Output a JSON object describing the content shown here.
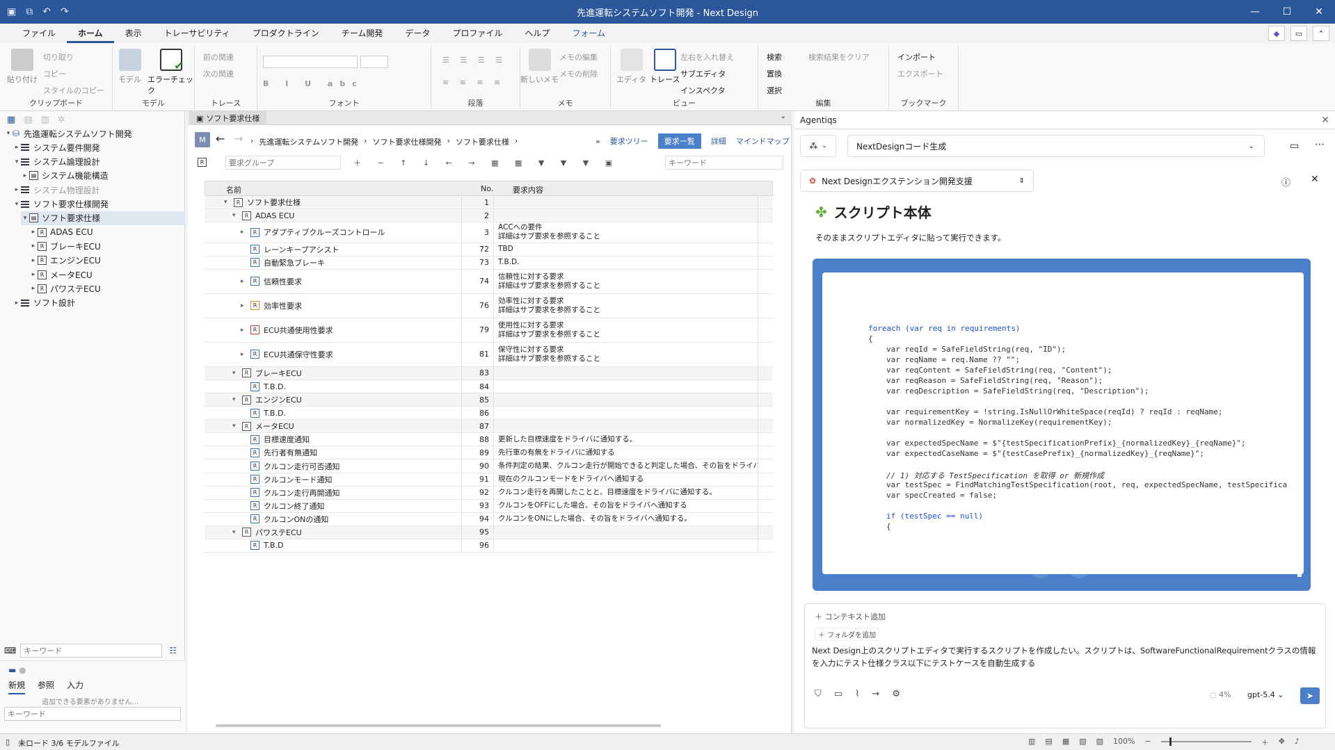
{
  "window": {
    "title": "先進運転システムソフト開発 - Next Design"
  },
  "menu": [
    "ファイル",
    "ホーム",
    "表示",
    "トレーサビリティ",
    "プロダクトライン",
    "チーム開発",
    "データ",
    "プロファイル",
    "ヘルプ",
    "フォーム"
  ],
  "ribbon": {
    "clipboard": {
      "paste": "貼り付け",
      "cut": "切り取り",
      "copy": "コピー",
      "style_copy": "スタイルのコピー",
      "label": "クリップボード"
    },
    "model": {
      "model": "モデル",
      "error_check": "エラーチェック",
      "label": "モデル"
    },
    "trace": {
      "prev": "前の関連",
      "next": "次の関連",
      "label": "トレース"
    },
    "font": {
      "label": "フォント"
    },
    "paragraph": {
      "label": "段落"
    },
    "memo": {
      "new_memo": "新しいメモ",
      "edit": "メモの編集",
      "delete": "メモの削除",
      "label": "メモ"
    },
    "view": {
      "editor": "エディタ",
      "trace": "トレース",
      "swap": "左右を入れ替え",
      "subeditor": "サブエディタ",
      "inspector": "インスペクタ",
      "label": "ビュー"
    },
    "edit": {
      "search": "検索",
      "replace": "置換",
      "select": "選択",
      "clear": "検索結果をクリア",
      "label": "編集"
    },
    "bookmark": {
      "import": "インポート",
      "export": "エクスポート",
      "label": "ブックマーク"
    }
  },
  "left": {
    "tree": [
      {
        "label": "先進運転システムソフト開発",
        "level": 0,
        "icon": "project-icon",
        "toggle": "▾"
      },
      {
        "label": "システム要件開発",
        "level": 1,
        "icon": "list-icon",
        "toggle": "▸"
      },
      {
        "label": "システム論理設計",
        "level": 1,
        "icon": "list-icon",
        "toggle": "▾"
      },
      {
        "label": "システム機能構造",
        "level": 2,
        "icon": "diagram-icon",
        "toggle": "▸"
      },
      {
        "label": "システム物理設計",
        "level": 1,
        "icon": "list-icon",
        "toggle": "▸",
        "dim": true
      },
      {
        "label": "ソフト要求仕様開発",
        "level": 1,
        "icon": "list-icon",
        "toggle": "▾"
      },
      {
        "label": "ソフト要求仕様",
        "level": 2,
        "icon": "diagram-icon",
        "toggle": "▾",
        "selected": true
      },
      {
        "label": "ADAS ECU",
        "level": 3,
        "icon": "r-icon",
        "toggle": "▸"
      },
      {
        "label": "ブレーキECU",
        "level": 3,
        "icon": "r-icon",
        "toggle": "▸"
      },
      {
        "label": "エンジンECU",
        "level": 3,
        "icon": "r-icon",
        "toggle": "▸"
      },
      {
        "label": "メータECU",
        "level": 3,
        "icon": "r-icon",
        "toggle": "▸"
      },
      {
        "label": "パワステECU",
        "level": 3,
        "icon": "r-icon",
        "toggle": "▸"
      },
      {
        "label": "ソフト設計",
        "level": 1,
        "icon": "list-icon",
        "toggle": "▸"
      }
    ],
    "keyword_placeholder": "キーワード",
    "tabs": [
      "新規",
      "参照",
      "入力"
    ],
    "empty_msg": "追加できる要素がありません...",
    "keyword2_placeholder": "キーワード"
  },
  "center": {
    "doc_tab": "ソフト要求仕様",
    "breadcrumb": [
      "先進運転システムソフト開発",
      "ソフト要求仕様開発",
      "ソフト要求仕様"
    ],
    "views": [
      "要求ツリー",
      "要求一覧",
      "詳細",
      "マインドマップ"
    ],
    "group_placeholder": "要求グループ",
    "keyword_placeholder": "キーワード",
    "columns": [
      "名前",
      "No.",
      "要求内容"
    ],
    "rows": [
      {
        "name": "ソフト要求仕様",
        "no": "1",
        "content": [],
        "indent": 0,
        "toggle": "▾",
        "group": true,
        "h": 18
      },
      {
        "name": "ADAS ECU",
        "no": "2",
        "content": [],
        "indent": 1,
        "toggle": "▾",
        "group": true,
        "h": 18
      },
      {
        "name": "アダプティブクルーズコントロール",
        "no": "3",
        "content": [
          "ACCへの要件",
          "詳細はサブ要求を参照すること"
        ],
        "indent": 2,
        "toggle": "▸",
        "h": 28
      },
      {
        "name": "レーンキープアシスト",
        "no": "72",
        "content": [
          "TBD"
        ],
        "indent": 2,
        "h": 18
      },
      {
        "name": "自動緊急ブレーキ",
        "no": "73",
        "content": [
          "T.B.D."
        ],
        "indent": 2,
        "h": 18
      },
      {
        "name": "信頼性要求",
        "no": "74",
        "content": [
          "信頼性に対する要求",
          "詳細はサブ要求を参照すること"
        ],
        "indent": 2,
        "toggle": "▸",
        "h": 33
      },
      {
        "name": "効率性要求",
        "no": "76",
        "content": [
          "効率性に対する要求",
          "詳細はサブ要求を参照すること"
        ],
        "indent": 2,
        "toggle": "▸",
        "h": 33,
        "orange": true
      },
      {
        "name": "ECU共通使用性要求",
        "no": "79",
        "content": [
          "使用性に対する要求",
          "詳細はサブ要求を参照すること"
        ],
        "indent": 2,
        "toggle": "▸",
        "h": 33,
        "red": true
      },
      {
        "name": "ECU共通保守性要求",
        "no": "81",
        "content": [
          "保守性に対する要求",
          "詳細はサブ要求を参照すること"
        ],
        "indent": 2,
        "toggle": "▸",
        "h": 33
      },
      {
        "name": "ブレーキECU",
        "no": "83",
        "content": [],
        "indent": 1,
        "toggle": "▾",
        "group": true,
        "h": 18
      },
      {
        "name": "T.B.D.",
        "no": "84",
        "content": [],
        "indent": 2,
        "h": 18
      },
      {
        "name": "エンジンECU",
        "no": "85",
        "content": [],
        "indent": 1,
        "toggle": "▾",
        "group": true,
        "h": 18
      },
      {
        "name": "T.B.D.",
        "no": "86",
        "content": [],
        "indent": 2,
        "h": 18
      },
      {
        "name": "メータECU",
        "no": "87",
        "content": [],
        "indent": 1,
        "toggle": "▾",
        "group": true,
        "h": 18
      },
      {
        "name": "目標速度通知",
        "no": "88",
        "content": [
          "更新した目標速度をドライバに通知する。"
        ],
        "indent": 2,
        "h": 18
      },
      {
        "name": "先行者有無通知",
        "no": "89",
        "content": [
          "先行車の有無をドライバに通知する"
        ],
        "indent": 2,
        "h": 18
      },
      {
        "name": "クルコン走行可否通知",
        "no": "90",
        "content": [
          "条件判定の結果、クルコン走行が開始できると判定した場合、その旨をドライバへ通知する"
        ],
        "indent": 2,
        "h": 18
      },
      {
        "name": "クルコンモード通知",
        "no": "91",
        "content": [
          "現在のクルコンモードをドライバへ通知する"
        ],
        "indent": 2,
        "h": 18
      },
      {
        "name": "クルコン走行再開通知",
        "no": "92",
        "content": [
          "クルコン走行を再開したことと、目標速度をドライバに通知する。"
        ],
        "indent": 2,
        "h": 18
      },
      {
        "name": "クルコン終了通知",
        "no": "93",
        "content": [
          "クルコンをOFFにした場合、その旨をドライバへ通知する"
        ],
        "indent": 2,
        "h": 18
      },
      {
        "name": "クルコンONの通知",
        "no": "94",
        "content": [
          "クルコンをONにした場合、その旨をドライバへ通知する。"
        ],
        "indent": 2,
        "h": 18
      },
      {
        "name": "パワステECU",
        "no": "95",
        "content": [],
        "indent": 1,
        "toggle": "▾",
        "group": true,
        "h": 18
      },
      {
        "name": "T.B.D",
        "no": "96",
        "content": [],
        "indent": 2,
        "h": 18
      }
    ]
  },
  "right": {
    "panel_title": "Agentiqs",
    "agent_select": "NextDesignコード生成",
    "skill": "Next Designエクステンション開発支援",
    "heading": "スクリプト本体",
    "heading_icon": "puzzle-icon",
    "desc": "そのままスクリプトエディタに貼って実行できます。",
    "code_lang": "csharp",
    "code_lines": [
      {
        "t": "foreach (var req in requirements)",
        "i": 0
      },
      {
        "t": "{",
        "i": 0
      },
      {
        "t": "var reqId = SafeFieldString(req, \"ID\");",
        "i": 1
      },
      {
        "t": "var reqName = req.Name ?? \"\";",
        "i": 1
      },
      {
        "t": "var reqContent = SafeFieldString(req, \"Content\");",
        "i": 1
      },
      {
        "t": "var reqReason = SafeFieldString(req, \"Reason\");",
        "i": 1
      },
      {
        "t": "var reqDescription = SafeFieldString(req, \"Description\");",
        "i": 1
      },
      {
        "t": "",
        "i": 1
      },
      {
        "t": "var requirementKey = !string.IsNullOrWhiteSpace(reqId) ? reqId : reqName;",
        "i": 1
      },
      {
        "t": "var normalizedKey = NormalizeKey(requirementKey);",
        "i": 1
      },
      {
        "t": "",
        "i": 1
      },
      {
        "t": "var expectedSpecName = $\"{testSpecificationPrefix}_{normalizedKey}_{reqName}\";",
        "i": 1
      },
      {
        "t": "var expectedCaseName = $\"{testCasePrefix}_{normalizedKey}_{reqName}\";",
        "i": 1
      },
      {
        "t": "",
        "i": 1
      },
      {
        "t": "// 1) 対応する TestSpecification を取得 or 新規作成",
        "i": 1,
        "c": true
      },
      {
        "t": "var testSpec = FindMatchingTestSpecification(root, req, expectedSpecName, testSpecifica",
        "i": 1
      },
      {
        "t": "var specCreated = false;",
        "i": 1
      },
      {
        "t": "",
        "i": 1
      },
      {
        "t": "if (testSpec == null)",
        "i": 1
      },
      {
        "t": "{",
        "i": 1
      }
    ],
    "context_add": "コンテキスト追加",
    "folder_add": "フォルダを追加",
    "prompt": "Next Design上のスクリプトエディタで実行するスクリプトを作成したい。スクリプトは、SoftwareFunctionalRequirementクラスの情報を入力にテスト仕様クラス以下にテストケースを自動生成する",
    "usage": "4%",
    "model": "gpt-5.4"
  },
  "status": {
    "text": "未ロード 3/6 モデルファイル",
    "zoom": "100%"
  }
}
